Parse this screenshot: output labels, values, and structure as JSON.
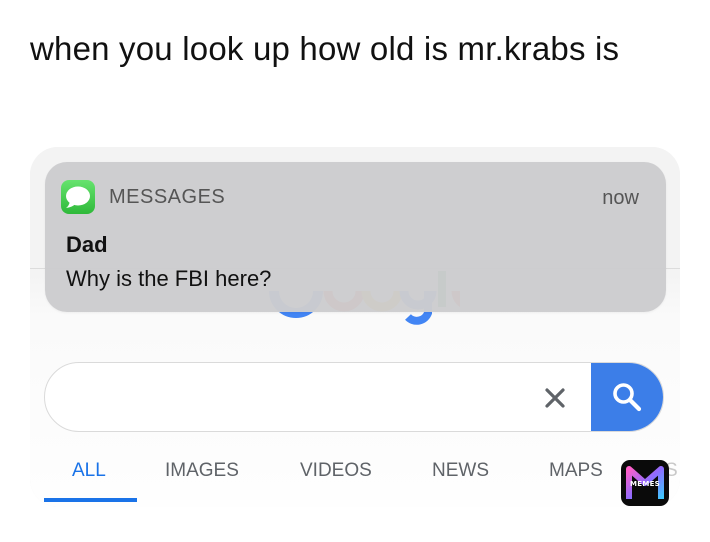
{
  "caption": "when you look up how old is mr.krabs is",
  "notification": {
    "app_name": "MESSAGES",
    "time": "now",
    "sender": "Dad",
    "message": "Why is the FBI here?",
    "icon": "messages-app-icon",
    "icon_color": "#34c759"
  },
  "search": {
    "value": "",
    "placeholder": "",
    "clear_glyph": "×",
    "clear_icon": "close-icon",
    "search_icon": "search-icon",
    "button_color": "#3c7ee8"
  },
  "tabs": {
    "items": [
      {
        "label": "ALL",
        "active": true
      },
      {
        "label": "IMAGES",
        "active": false
      },
      {
        "label": "VIDEOS",
        "active": false
      },
      {
        "label": "NEWS",
        "active": false
      },
      {
        "label": "MAPS",
        "active": false
      }
    ],
    "overflow_fragment": "S",
    "active_color": "#1a73e8"
  },
  "watermark": {
    "label": "MEMES",
    "icon": "memes-logo-icon"
  }
}
